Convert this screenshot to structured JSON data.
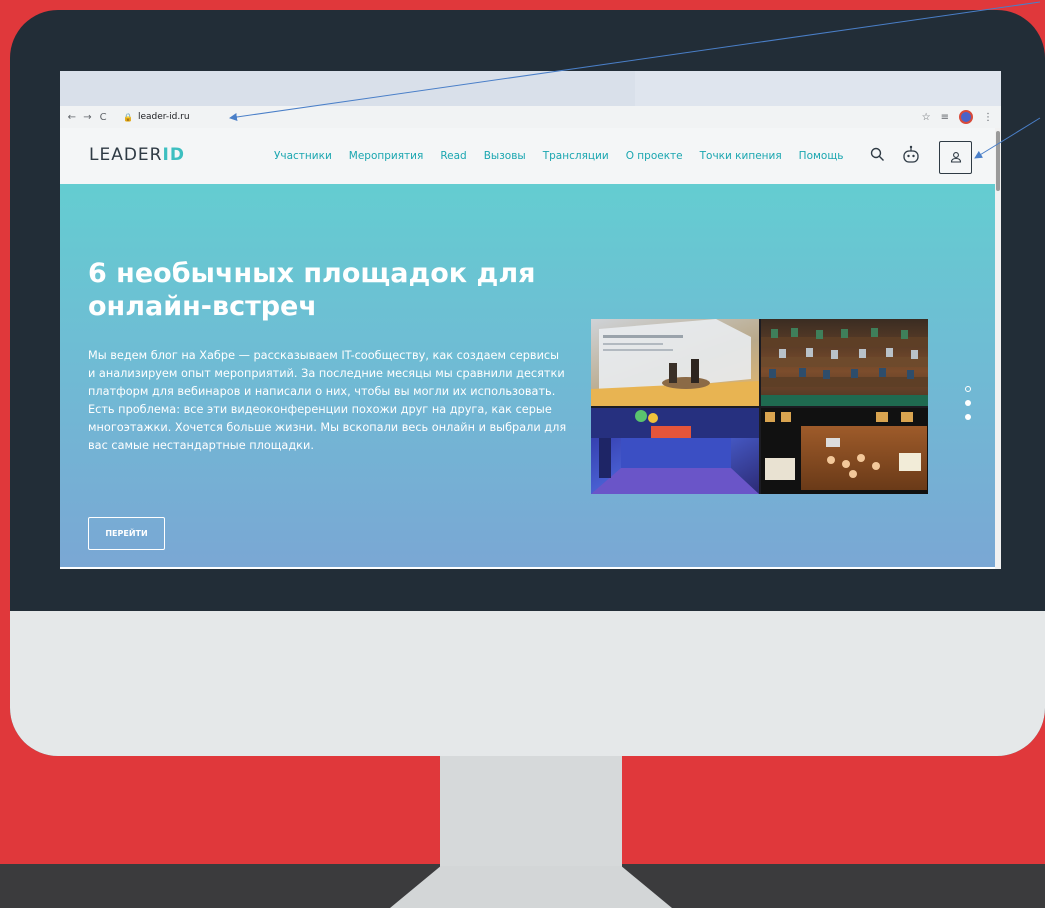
{
  "browser": {
    "url": "leader-id.ru"
  },
  "site": {
    "logo_text": "LEADER",
    "logo_accent": "ID",
    "menu": [
      {
        "label": "Участники"
      },
      {
        "label": "Мероприятия"
      },
      {
        "label": "Read"
      },
      {
        "label": "Вызовы"
      },
      {
        "label": "Трансляции"
      },
      {
        "label": "О проекте"
      },
      {
        "label": "Точки кипения"
      },
      {
        "label": "Помощь"
      }
    ]
  },
  "hero": {
    "title": "6 необычных площадок для онлайн-встреч",
    "text": "Мы ведем блог на Хабре — рассказываем IT-сообществу, как создаем сервисы и анализируем опыт мероприятий. За последние месяцы мы сравнили десятки платформ для вебинаров и написали о них, чтобы вы могли их использовать. Есть проблема: все эти видеоконференции похожи друг на друга, как серые многоэтажки. Хочется больше жизни. Мы вскопали весь онлайн и выбрали для вас самые нестандартные площадки.",
    "button_label": "ПЕРЕЙТИ",
    "slides_total": 3,
    "active_slide": 1
  },
  "colors": {
    "background_red": "#e0383b",
    "monitor_frame": "#222d37",
    "accent_teal": "#1aa6b0",
    "pointer_line": "#4a7fc8"
  },
  "icons": [
    "back-arrow-icon",
    "forward-arrow-icon",
    "reload-icon",
    "lock-icon",
    "star-icon",
    "playlist-icon",
    "profile-extension-icon",
    "more-vert-icon",
    "search-icon",
    "robot-icon",
    "user-icon"
  ]
}
